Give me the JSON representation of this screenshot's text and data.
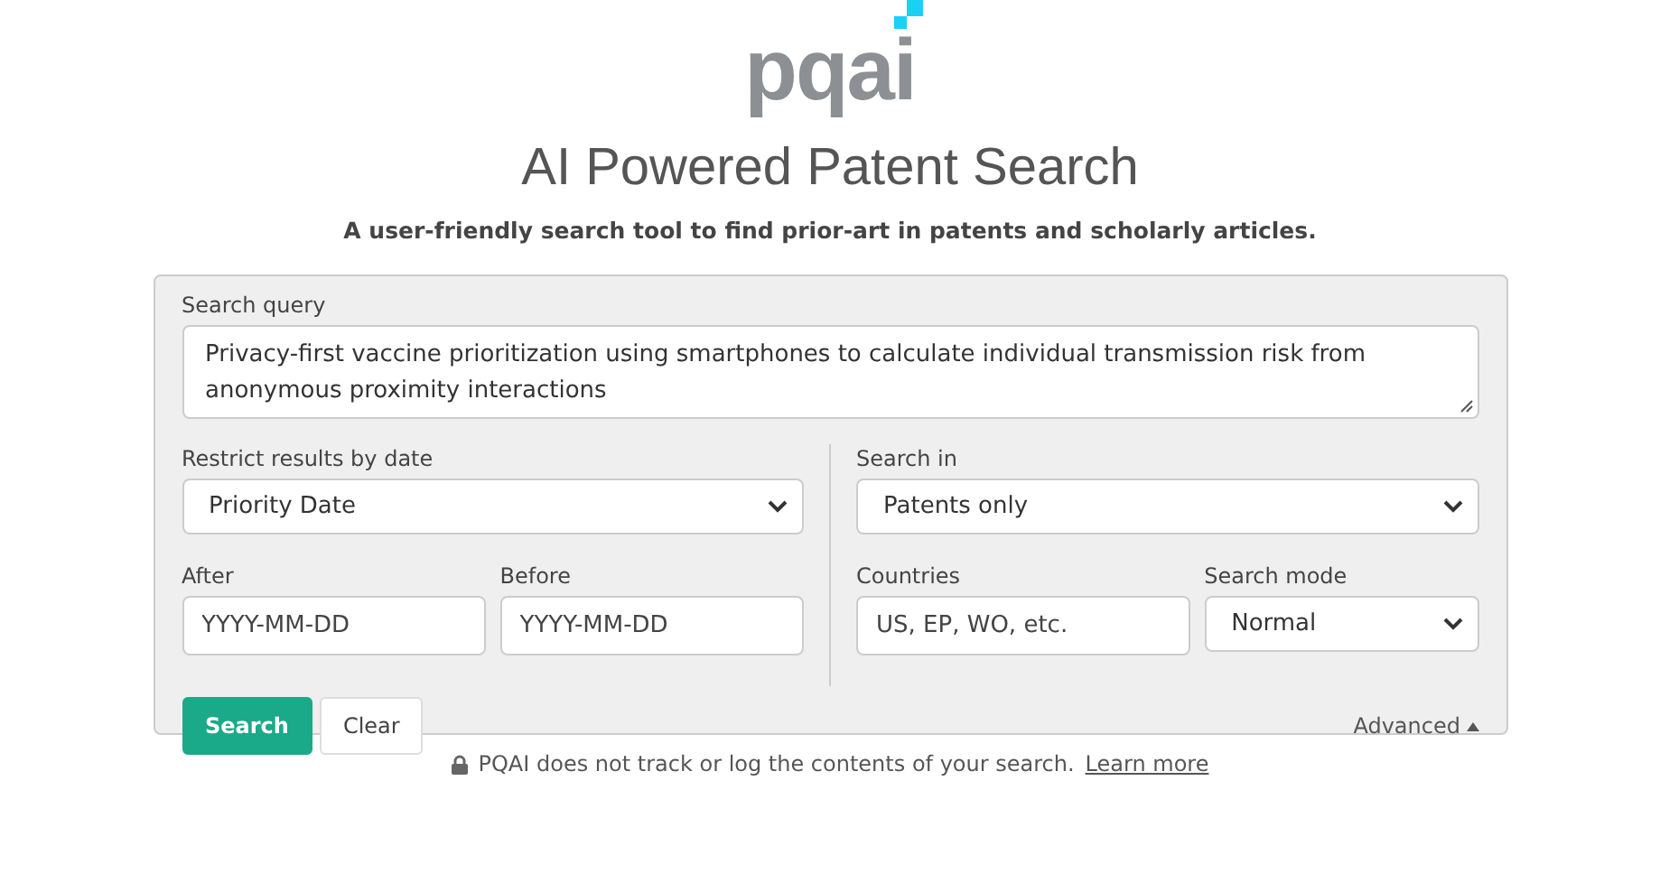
{
  "logo": {
    "text": "pqai"
  },
  "title": "AI Powered Patent Search",
  "subtitle": "A user-friendly search tool to find prior-art in patents and scholarly articles.",
  "form": {
    "query": {
      "label": "Search query",
      "value": "Privacy-first vaccine prioritization using smartphones to calculate individual transmission risk from anonymous proximity interactions"
    },
    "date_restrict": {
      "label": "Restrict results by date",
      "value": "Priority Date"
    },
    "after": {
      "label": "After",
      "placeholder": "YYYY-MM-DD"
    },
    "before": {
      "label": "Before",
      "placeholder": "YYYY-MM-DD"
    },
    "search_in": {
      "label": "Search in",
      "value": "Patents only"
    },
    "countries": {
      "label": "Countries",
      "placeholder": "US, EP, WO, etc."
    },
    "search_mode": {
      "label": "Search mode",
      "value": "Normal"
    },
    "buttons": [
      {
        "label": "Search",
        "kind": "primary"
      },
      {
        "label": "Clear",
        "kind": "secondary"
      }
    ],
    "advanced": {
      "label": "Advanced"
    }
  },
  "footer": {
    "text": "PQAI does not track or log the contents of your search.",
    "link": "Learn more"
  }
}
